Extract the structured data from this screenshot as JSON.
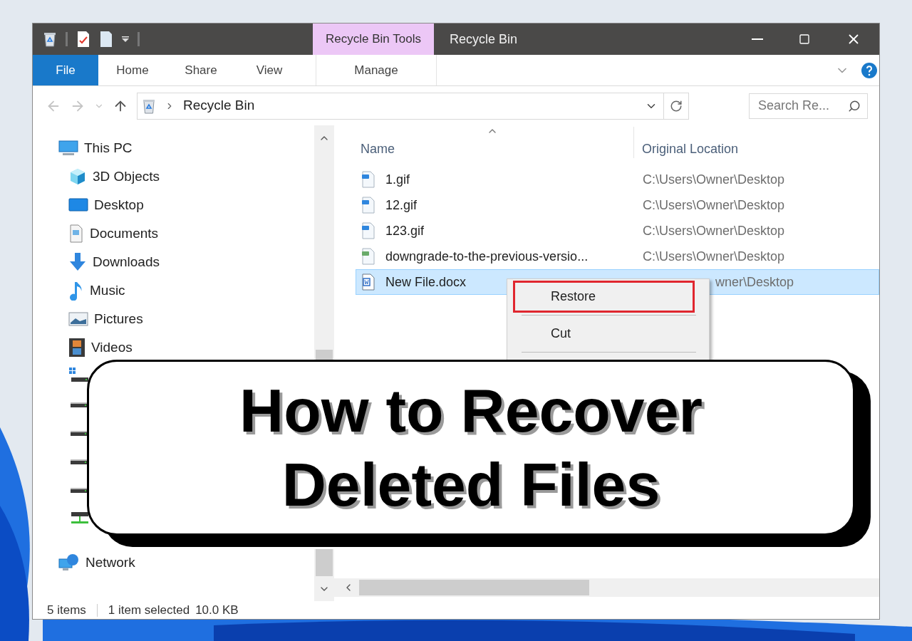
{
  "title_bar": {
    "contextual_tab": "Recycle Bin Tools",
    "title": "Recycle Bin"
  },
  "ribbon_tabs": [
    {
      "label": "File",
      "kind": "file"
    },
    {
      "label": "Home",
      "kind": "plain"
    },
    {
      "label": "Share",
      "kind": "plain"
    },
    {
      "label": "View",
      "kind": "plain"
    },
    {
      "label": "Manage",
      "kind": "contextual"
    }
  ],
  "address_bar": {
    "path": "Recycle Bin"
  },
  "search": {
    "placeholder": "Search Re..."
  },
  "nav_pane": {
    "items": [
      {
        "label": "This PC",
        "kind": "pc",
        "children": [
          {
            "label": "3D Objects",
            "kind": "cube"
          },
          {
            "label": "Desktop",
            "kind": "desktop"
          },
          {
            "label": "Documents",
            "kind": "documents"
          },
          {
            "label": "Downloads",
            "kind": "downloads"
          },
          {
            "label": "Music",
            "kind": "music"
          },
          {
            "label": "Pictures",
            "kind": "pictures"
          },
          {
            "label": "Videos",
            "kind": "videos"
          },
          {
            "kind": "windows-drive"
          },
          {
            "kind": "drive"
          },
          {
            "kind": "drive"
          },
          {
            "kind": "drive"
          },
          {
            "kind": "drive"
          },
          {
            "kind": "network-drive"
          }
        ]
      },
      {
        "label": "Network",
        "kind": "network"
      }
    ]
  },
  "columns": [
    "Name",
    "Original Location"
  ],
  "rows": [
    {
      "name": "1.gif",
      "kind": "image",
      "location": "C:\\Users\\Owner\\Desktop",
      "selected": false
    },
    {
      "name": "12.gif",
      "kind": "image",
      "location": "C:\\Users\\Owner\\Desktop",
      "selected": false
    },
    {
      "name": "123.gif",
      "kind": "image",
      "location": "C:\\Users\\Owner\\Desktop",
      "selected": false
    },
    {
      "name": "downgrade-to-the-previous-versio...",
      "kind": "picture",
      "location": "C:\\Users\\Owner\\Desktop",
      "selected": false
    },
    {
      "name": "New File.docx",
      "kind": "word",
      "location": "wner\\Desktop",
      "selected": true
    }
  ],
  "context_menu": {
    "items": [
      {
        "label": "Restore",
        "highlighted": true
      },
      {
        "label": "Cut",
        "highlighted": false
      }
    ]
  },
  "status_bar": {
    "item_count": "5 items",
    "selection": "1 item selected",
    "size": "10.0 KB"
  },
  "banner": {
    "lines": [
      "How to Recover",
      "Deleted Files"
    ]
  }
}
